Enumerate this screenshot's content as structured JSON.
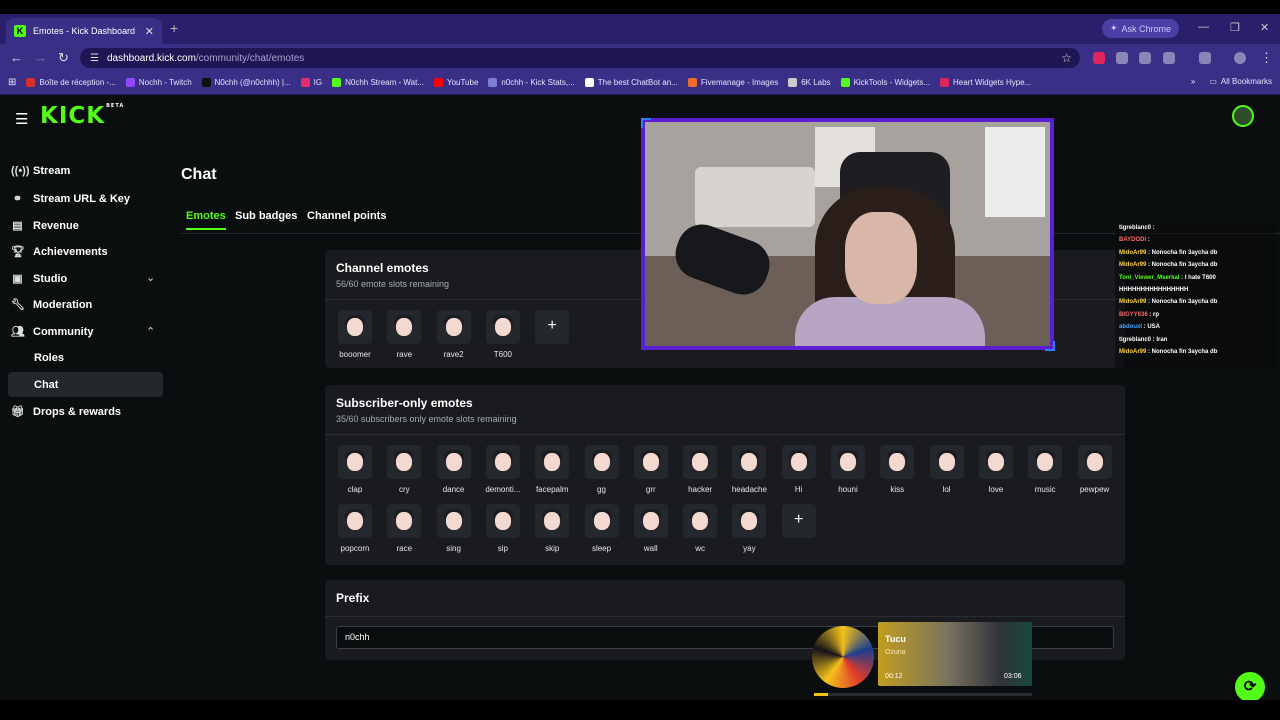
{
  "browser": {
    "tab_title": "Emotes - Kick Dashboard",
    "tab_favicon": "K",
    "ask_chrome": "Ask Chrome",
    "url_host": "dashboard.kick.com",
    "url_path": "/community/chat/emotes",
    "bookmarks": [
      {
        "label": "Boîte de réception -...",
        "color": "#d93025"
      },
      {
        "label": "Nochh - Twitch",
        "color": "#9146ff"
      },
      {
        "label": "N0chh (@n0chhh) |...",
        "color": "#111111"
      },
      {
        "label": "IG",
        "color": "#e1306c"
      },
      {
        "label": "N0chh Stream - Wat...",
        "color": "#53fc18"
      },
      {
        "label": "YouTube",
        "color": "#ff0000"
      },
      {
        "label": "n0chh - Kick Stats,...",
        "color": "#7a7fd1"
      },
      {
        "label": "The best ChatBot an...",
        "color": "#ffffff"
      },
      {
        "label": "Fivemanage - Images",
        "color": "#f06b2c"
      },
      {
        "label": "6K Labs",
        "color": "#cccccc"
      },
      {
        "label": "KickTools - Widgets...",
        "color": "#53fc18"
      },
      {
        "label": "Heart Widgets Hype...",
        "color": "#e0245e"
      }
    ],
    "all_bookmarks": "All Bookmarks"
  },
  "app": {
    "logo": "KICK",
    "logo_badge": "BETA",
    "accent_color": "#53fc18"
  },
  "sidebar": {
    "items": [
      {
        "label": "Stream",
        "icon": "stream-icon"
      },
      {
        "label": "Stream URL & Key",
        "icon": "link-icon"
      },
      {
        "label": "Revenue",
        "icon": "chart-icon"
      },
      {
        "label": "Achievements",
        "icon": "trophy-icon"
      },
      {
        "label": "Studio",
        "icon": "studio-icon"
      },
      {
        "label": "Moderation",
        "icon": "wrench-icon"
      },
      {
        "label": "Community",
        "icon": "community-icon"
      },
      {
        "label": "Drops & rewards",
        "icon": "gift-icon"
      }
    ],
    "sub_items": [
      {
        "label": "Roles"
      },
      {
        "label": "Chat"
      }
    ]
  },
  "main": {
    "title": "Chat",
    "tabs": [
      "Emotes",
      "Sub badges",
      "Channel points"
    ],
    "channel_emotes": {
      "title": "Channel emotes",
      "subtitle": "56/60 emote slots remaining",
      "emotes": [
        "booomer",
        "rave",
        "rave2",
        "T600"
      ]
    },
    "subscriber_emotes": {
      "title": "Subscriber-only emotes",
      "subtitle": "35/60 subscribers only emote slots remaining",
      "emotes": [
        "clap",
        "cry",
        "dance",
        "demonti...",
        "facepalm",
        "gg",
        "grr",
        "hacker",
        "headache",
        "Hi",
        "houni",
        "kiss",
        "lol",
        "love",
        "music",
        "pewpew",
        "popcorn",
        "race",
        "sing",
        "sip",
        "skip",
        "sleep",
        "wall",
        "wc",
        "yay"
      ]
    },
    "prefix": {
      "title": "Prefix",
      "value": "n0chh"
    }
  },
  "overlay_chat": {
    "messages": [
      {
        "user": "tigreblanc0",
        "text": " : ",
        "color": "#ffffff"
      },
      {
        "user": "BAYDODI",
        "text": " : ",
        "color": "#ff6b6b"
      },
      {
        "user": "MidoAr99",
        "text": " : Nonocha fin 3aycha db",
        "color": "#ffd23f"
      },
      {
        "user": "MidoAr99",
        "text": " : Nonocha fin 3aycha db",
        "color": "#ffd23f"
      },
      {
        "user": "Toni_Viewer_Mserkal",
        "text": " : I hate T600",
        "color": "#53fc18"
      },
      {
        "user": "",
        "text": "HHHHHHHHHHHHHHHH",
        "color": "#ffffff"
      },
      {
        "user": "MidoAr99",
        "text": " : Nonocha fin 3aycha db",
        "color": "#ffd23f"
      },
      {
        "user": "BIGYY636",
        "text": " : rp",
        "color": "#ff6b6b"
      },
      {
        "user": "abdouxl",
        "text": " : USA",
        "color": "#4ea3ff"
      },
      {
        "user": "tigreblanc0",
        "text": " : Iran",
        "color": "#ffffff"
      },
      {
        "user": "MidoAr99",
        "text": " : Nonocha fin 3aycha db",
        "color": "#ffd23f"
      }
    ]
  },
  "music": {
    "song": "Tucu",
    "artist": "Ozuna",
    "elapsed": "00:12",
    "duration": "03:06",
    "progress": 0.065
  }
}
